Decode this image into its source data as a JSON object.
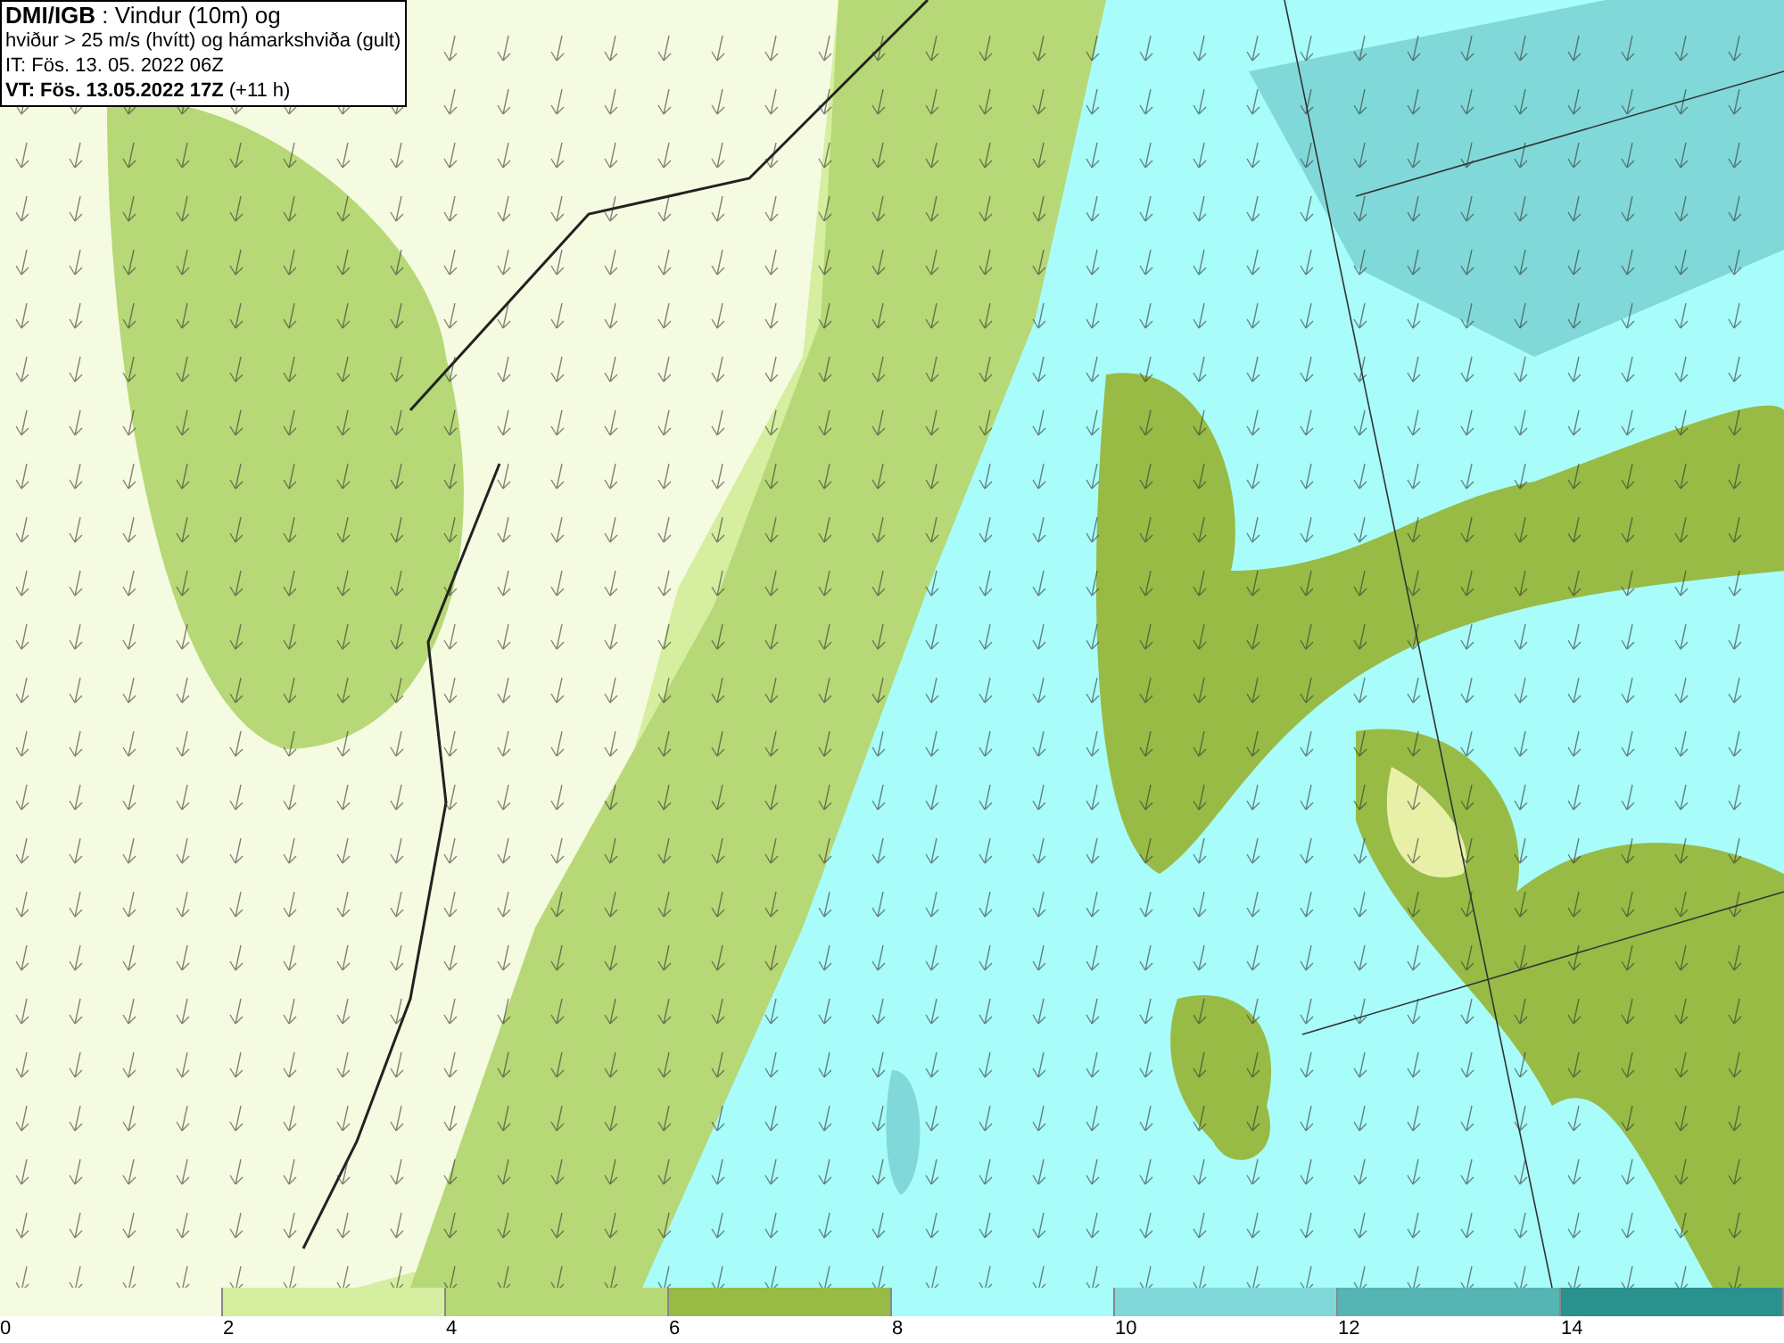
{
  "info_box": {
    "lines": [
      "**DMI/IGB** : Vindur (10m) og",
      "hviður > 25 m/s (hvítt) og hámarkshviða (gult)",
      "IT: Fös. 13. 05. 2022 06Z",
      "**VT: Fös. 13.05.2022 17Z** (+11 h)"
    ]
  },
  "legend": {
    "bins": [
      {
        "label": "0",
        "color": "#f5fbe0"
      },
      {
        "label": "2",
        "color": "#d6eea0"
      },
      {
        "label": "4",
        "color": "#b6d876"
      },
      {
        "label": "6",
        "color": "#97bb45"
      },
      {
        "label": "8",
        "color": "#a8fcfa"
      },
      {
        "label": "10",
        "color": "#80d9d8"
      },
      {
        "label": "12",
        "color": "#56b5b3"
      },
      {
        "label": "14",
        "color": "#2a918c"
      }
    ]
  }
}
